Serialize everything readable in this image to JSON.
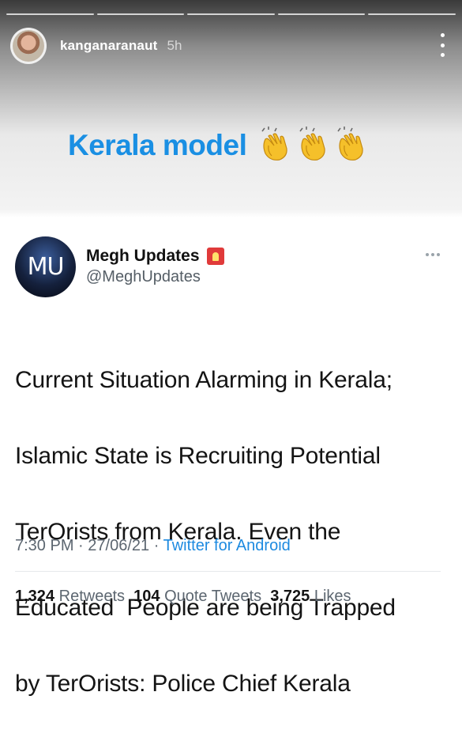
{
  "story": {
    "username": "kanganaranaut",
    "time": "5h",
    "caption": "Kerala model",
    "caption_emoji": "clapping-hands-icon",
    "caption_color": "#1a8fe3",
    "progress_segments": 5
  },
  "tweet": {
    "display_name": "Megh Updates",
    "name_badge_icon": "police-siren-icon",
    "handle": "@MeghUpdates",
    "avatar_text": "MU",
    "text_lines": [
      "Current Situation Alarming in Kerala;",
      "Islamic State is Recruiting Potential",
      "TerOrists from Kerala. Even the",
      "Educated  People are being Trapped",
      "by TerOrists: Police Chief Kerala"
    ],
    "time": "7:30 PM",
    "date": "27/06/21",
    "separator": "·",
    "source": "Twitter for Android",
    "source_color": "#1d8ae0",
    "stats": {
      "retweets_count": "1,324",
      "retweets_label": "Retweets",
      "quotes_count": "104",
      "quotes_label": "Quote Tweets",
      "likes_count": "3,725",
      "likes_label": "Likes"
    }
  }
}
